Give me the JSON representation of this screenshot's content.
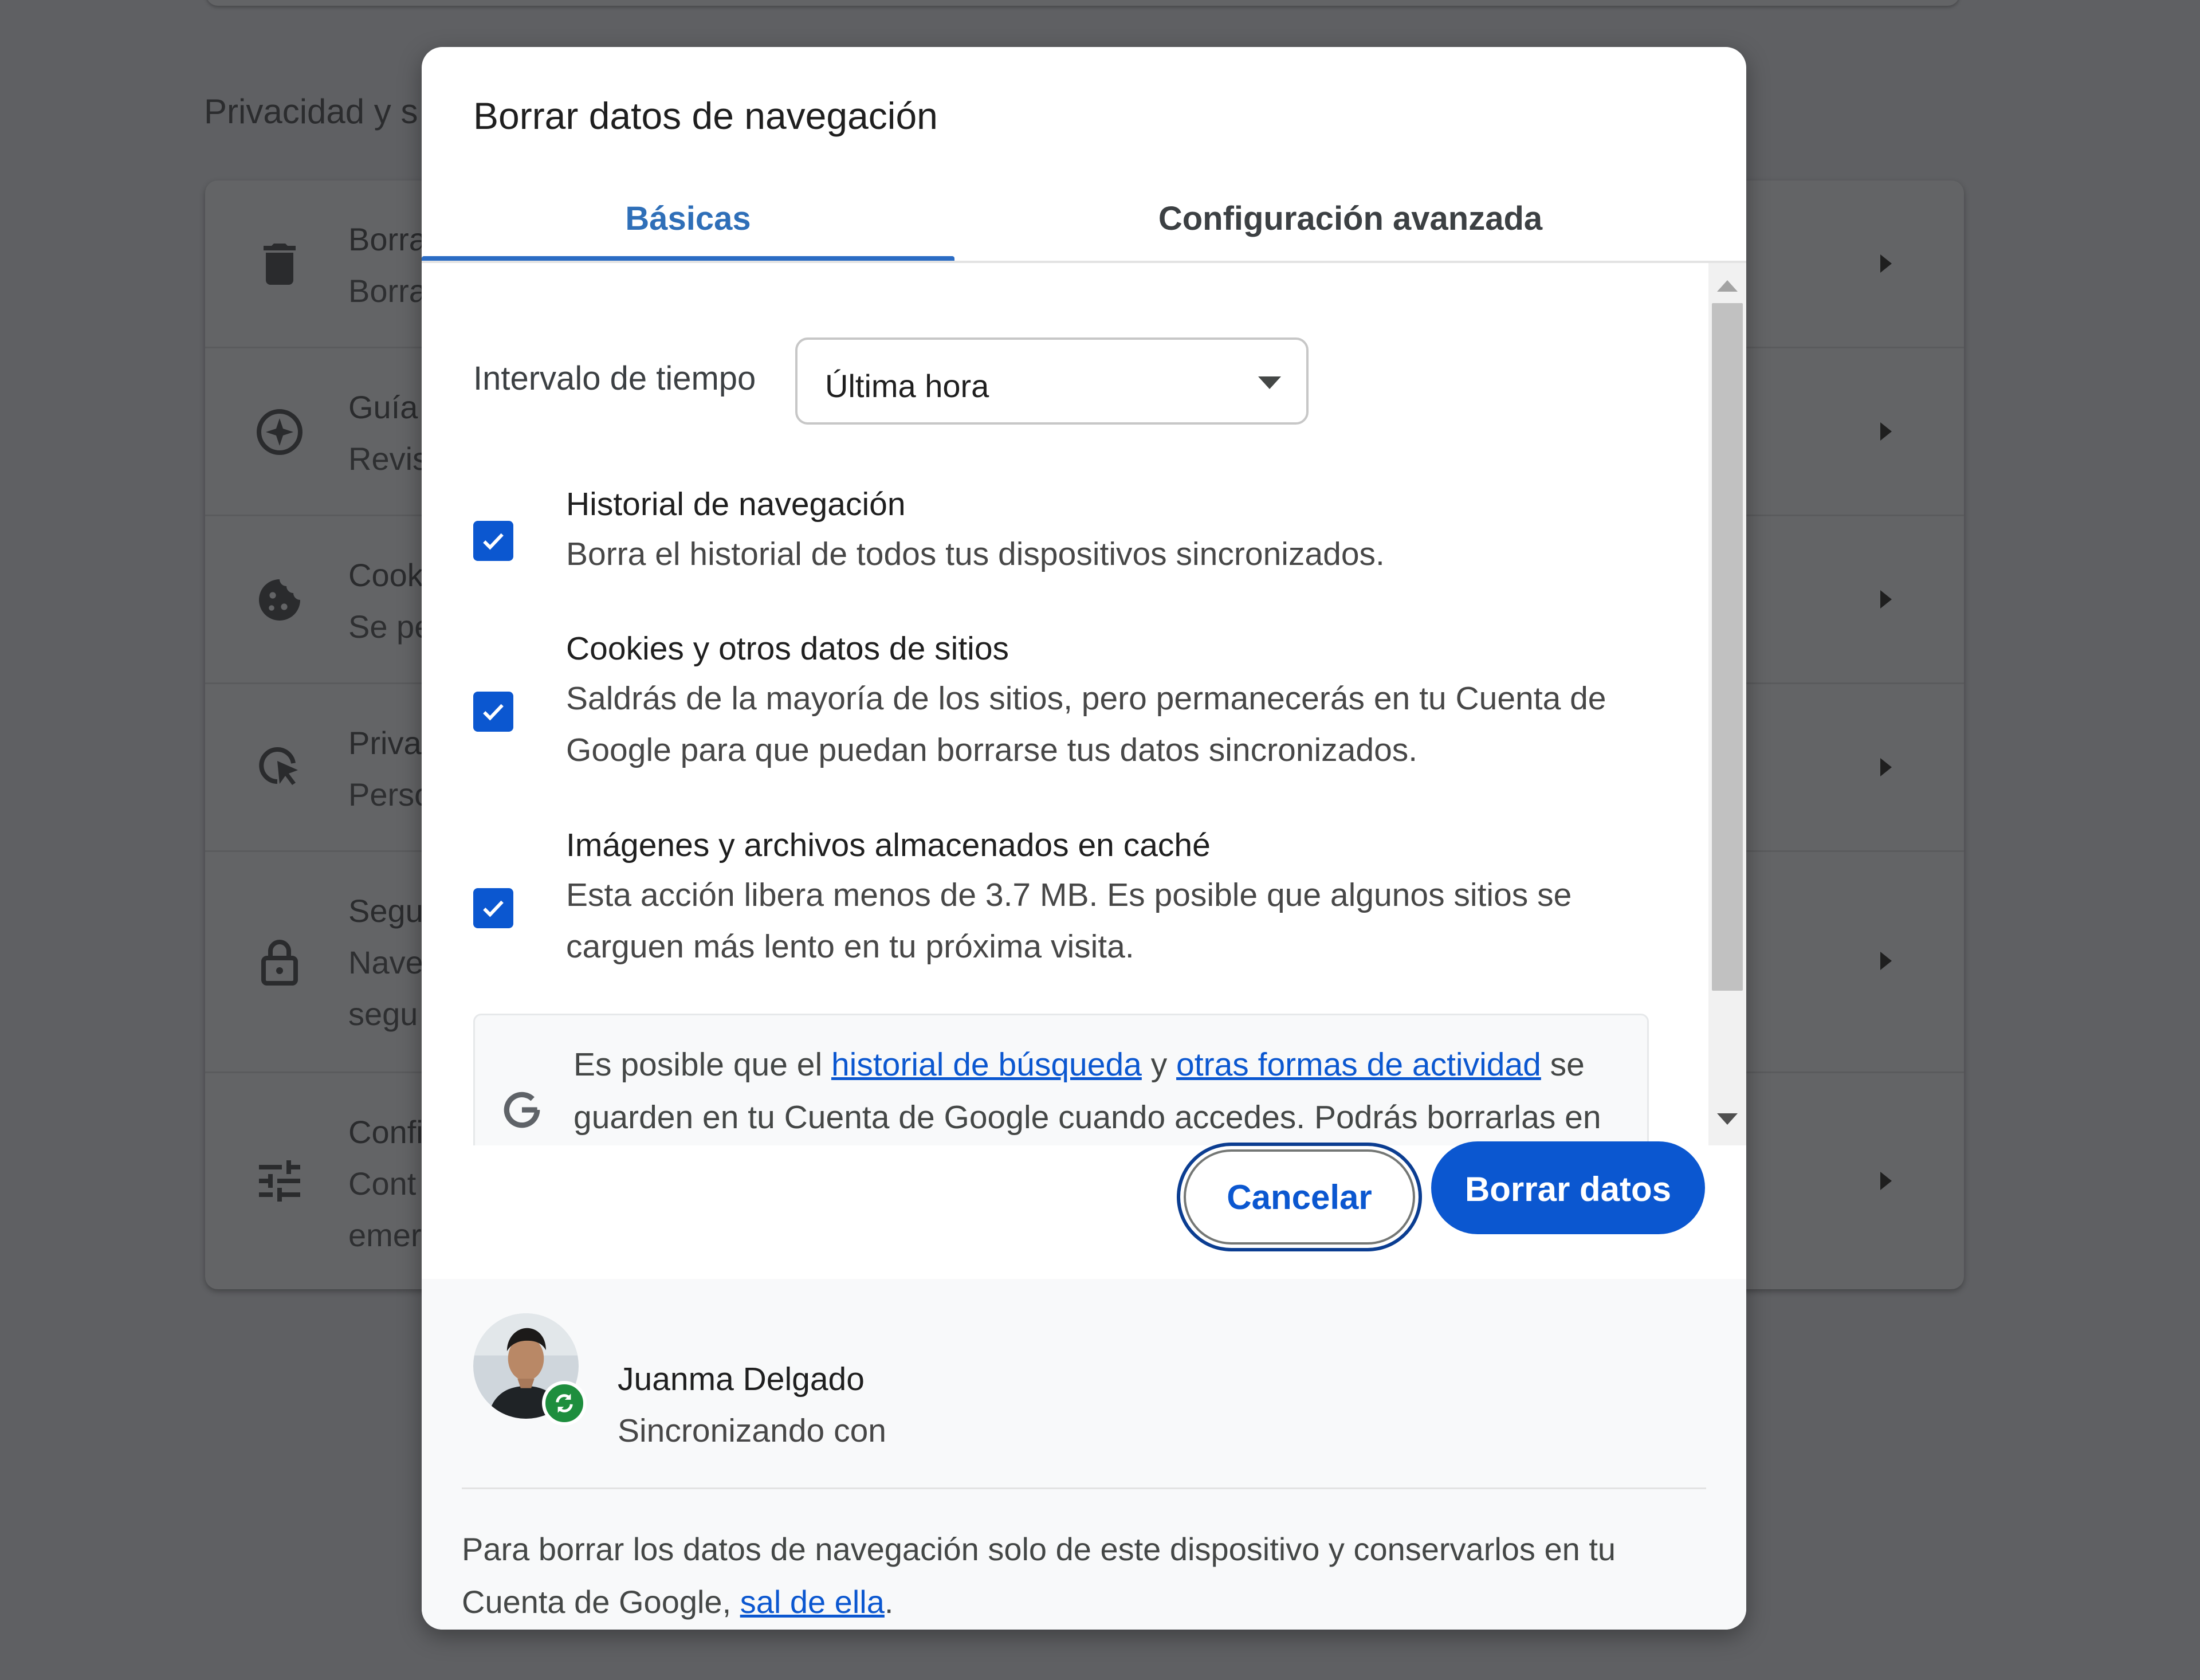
{
  "background": {
    "section_title": "Privacidad y s",
    "rows": [
      {
        "icon": "trash-icon",
        "line1": "Borra",
        "line2": "Borra",
        "line3": ""
      },
      {
        "icon": "compass-icon",
        "line1": "Guía",
        "line2": "Revis",
        "line3": ""
      },
      {
        "icon": "cookie-icon",
        "line1": "Cook",
        "line2": "Se pe",
        "line3": ""
      },
      {
        "icon": "privacy-sandbox-icon",
        "line1": "Priva",
        "line2": "Perso",
        "line3": ""
      },
      {
        "icon": "lock-icon",
        "line1": "Segu",
        "line2": "Nave",
        "line3": "segu"
      },
      {
        "icon": "tune-icon",
        "line1": "Confi",
        "line2": "Cont",
        "line3": "emer"
      }
    ]
  },
  "dialog": {
    "title": "Borrar datos de navegación",
    "tabs": [
      {
        "label": "Básicas",
        "active": true
      },
      {
        "label": "Configuración avanzada",
        "active": false
      }
    ],
    "time_range": {
      "label": "Intervalo de tiempo",
      "selected": "Última hora"
    },
    "items": [
      {
        "title": "Historial de navegación",
        "desc": "Borra el historial de todos tus dispositivos sincronizados.",
        "checked": true
      },
      {
        "title": "Cookies y otros datos de sitios",
        "desc": "Saldrás de la mayoría de los sitios, pero permanecerás en tu Cuenta de Google para que puedan borrarse tus datos sincronizados.",
        "checked": true
      },
      {
        "title": "Imágenes y archivos almacenados en caché",
        "desc": "Esta acción libera menos de 3.7 MB. Es posible que algunos sitios se carguen más lento en tu próxima visita.",
        "checked": true
      }
    ],
    "info": {
      "icon": "google-g-icon",
      "text_1": "Es posible que el ",
      "link_1": "historial de búsqueda",
      "text_2": " y ",
      "link_2": "otras formas de actividad",
      "text_3": " se guarden en tu Cuenta de Google cuando accedes. Podrás borrarlas en"
    },
    "buttons": {
      "cancel": "Cancelar",
      "delete": "Borrar datos"
    },
    "account": {
      "name": "Juanma Delgado",
      "status": "Sincronizando con"
    },
    "footer_note": {
      "text": "Para borrar los datos de navegación solo de este dispositivo y conservarlos en tu Cuenta de Google, ",
      "link": "sal de ella",
      "end": "."
    },
    "colors": {
      "accent": "#0b57d0",
      "sync_green": "#1e8e3e"
    }
  }
}
